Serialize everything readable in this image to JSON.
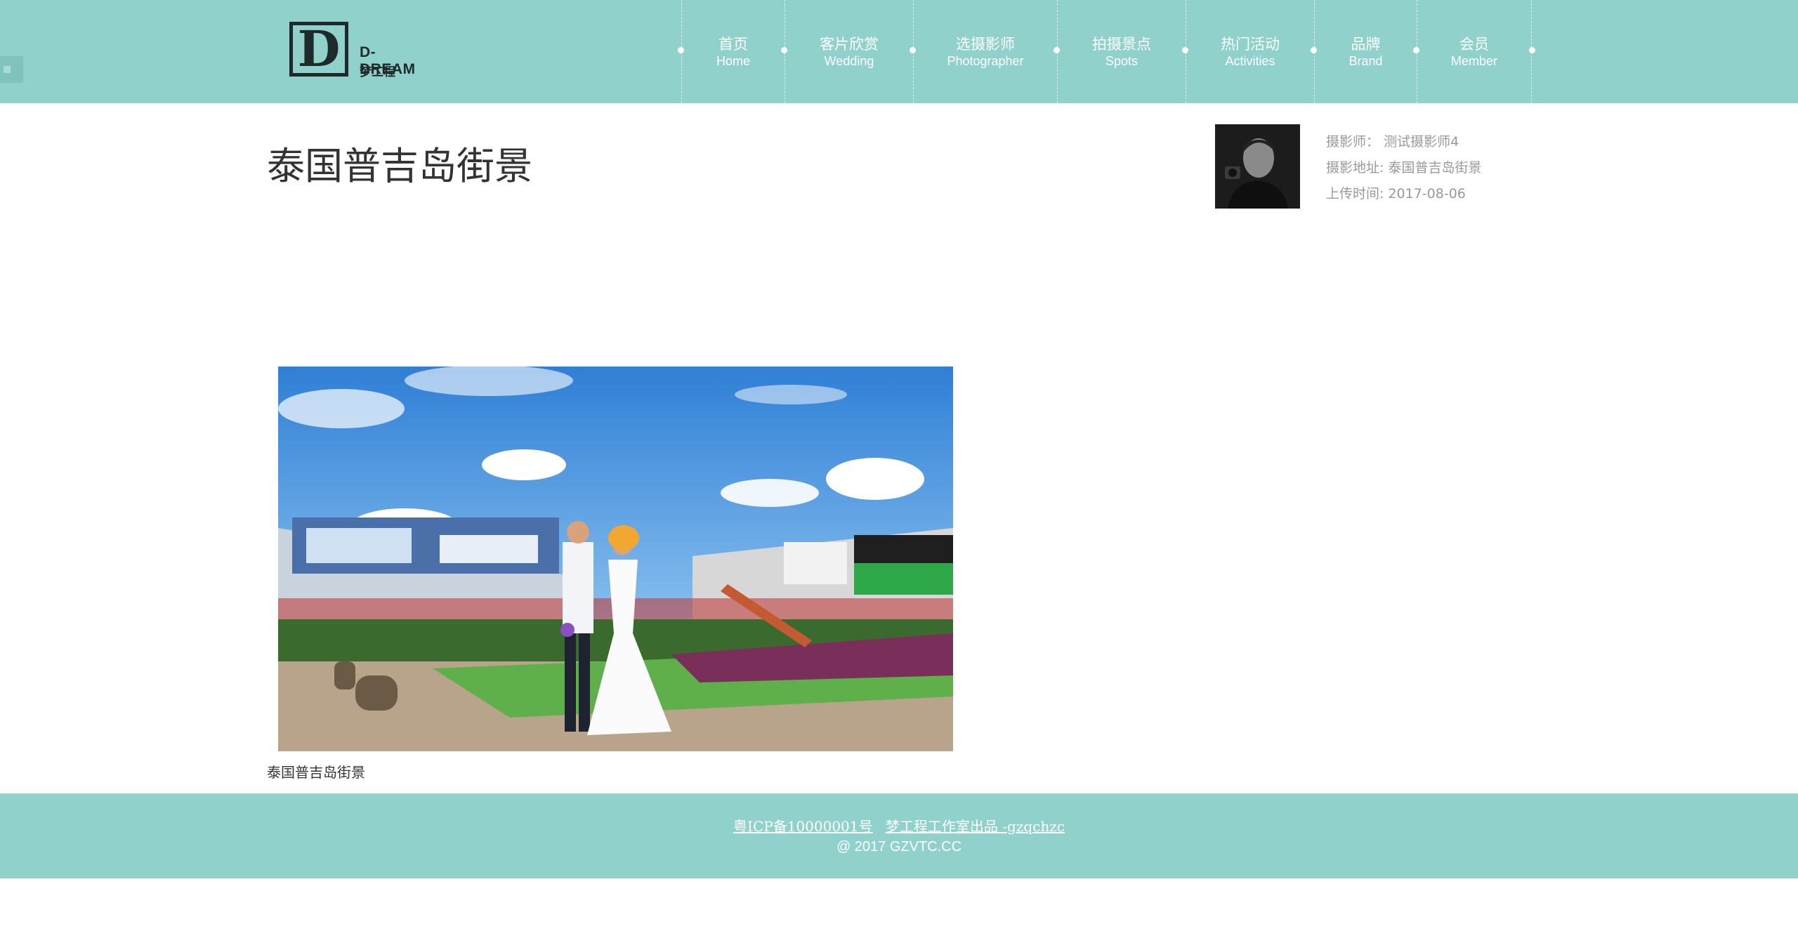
{
  "logo": {
    "name": "D-DREAM",
    "sub": "梦工程",
    "mark": "D"
  },
  "nav": [
    {
      "cn": "首页",
      "en": "Home"
    },
    {
      "cn": "客片欣赏",
      "en": "Wedding"
    },
    {
      "cn": "选摄影师",
      "en": "Photographer"
    },
    {
      "cn": "拍摄景点",
      "en": "Spots"
    },
    {
      "cn": "热门活动",
      "en": "Activities"
    },
    {
      "cn": "品牌",
      "en": "Brand"
    },
    {
      "cn": "会员",
      "en": "Member"
    }
  ],
  "page": {
    "title": "泰国普吉岛街景",
    "caption": "泰国普吉岛街景"
  },
  "meta": {
    "photographer_label": "摄影师：",
    "photographer": "测试摄影师4",
    "location_label": "摄影地址:",
    "location": "泰国普吉岛街景",
    "date_label": "上传时间:",
    "date": "2017-08-06"
  },
  "footer": {
    "icp": "粤ICP备10000001号",
    "studio": "梦工程工作室出品 -gzqchzc",
    "copyright": "@ 2017 GZVTC.CC"
  },
  "colors": {
    "brand": "#90d2cb",
    "text_dark": "#333333",
    "text_muted": "#999999"
  }
}
